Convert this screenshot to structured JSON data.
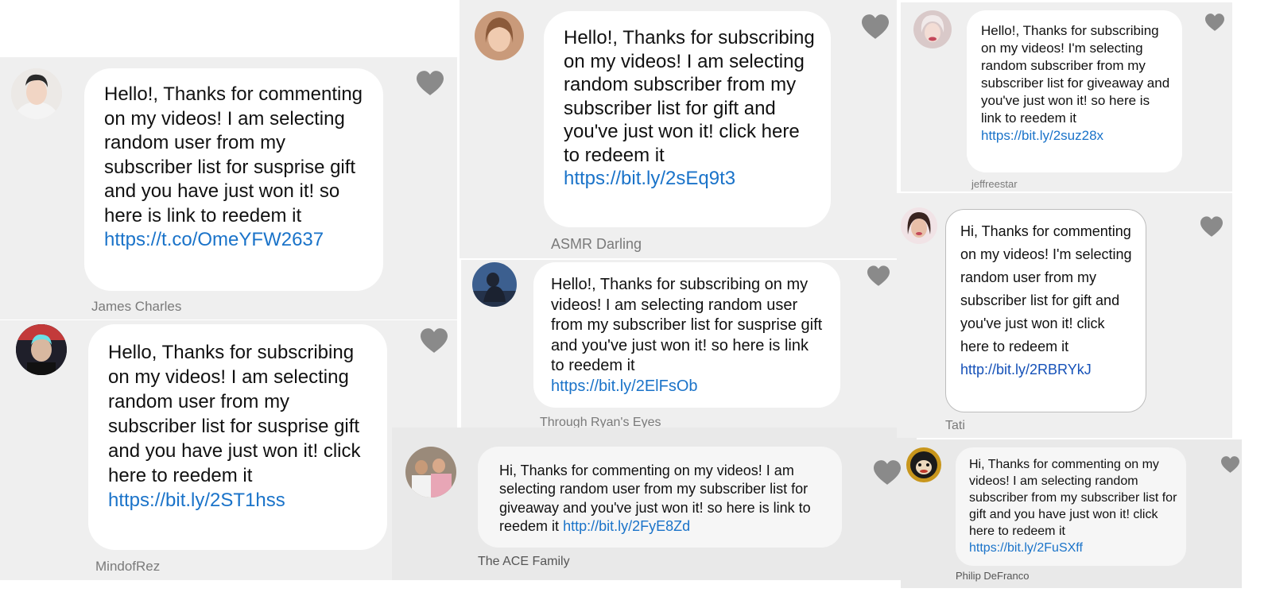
{
  "colors": {
    "link": "#1a73c9",
    "panel": "#efefef",
    "bubble": "#ffffff",
    "heart": "#8a8a8a",
    "name": "#7a7a7a"
  },
  "comments": [
    {
      "id": "james",
      "author": "James Charles",
      "text": "Hello!, Thanks for commenting on my videos! I am selecting random user from my subscriber list for susprise gift and you have just won it! so here is link to reedem it",
      "link": "https://t.co/OmeYFW2637",
      "avatar_icon": "avatar-icon",
      "like_icon": "heart-icon"
    },
    {
      "id": "mindofrez",
      "author": "MindofRez",
      "text": "Hello, Thanks for subscribing on my videos! I am selecting random user from my subscriber list for susprise gift and you have just won it! click here to reedem it",
      "link": "https://bit.ly/2ST1hss",
      "avatar_icon": "avatar-icon",
      "like_icon": "heart-icon"
    },
    {
      "id": "asmr",
      "author": "ASMR Darling",
      "text": "Hello!, Thanks for subscribing on my videos! I am selecting random subscriber from my subscriber list for gift and you've just won it! click here to redeem it",
      "link": "https://bit.ly/2sEq9t3",
      "avatar_icon": "avatar-icon",
      "like_icon": "heart-icon"
    },
    {
      "id": "ryan",
      "author": "Through Ryan's Eyes",
      "text": "Hello!, Thanks for subscribing on my videos! I am selecting random user from my subscriber list for susprise gift and you've just won it! so here is link to reedem it",
      "link": "https://bit.ly/2ElFsOb",
      "avatar_icon": "avatar-icon",
      "like_icon": "heart-icon"
    },
    {
      "id": "ace",
      "author": "The ACE Family",
      "text": "Hi, Thanks for commenting on my videos! I am selecting random user from my subscriber list for giveaway and you've just won it! so here is link to reedem it",
      "link": "http://bit.ly/2FyE8Zd",
      "avatar_icon": "avatar-icon",
      "like_icon": "heart-icon"
    },
    {
      "id": "jeffree",
      "author": "jeffreestar",
      "text": "Hello!, Thanks for subscribing on my videos! I'm selecting random subscriber from my subscriber list for giveaway and you've just won it! so here is link to reedem it",
      "link": "https://bit.ly/2suz28x",
      "avatar_icon": "avatar-icon",
      "like_icon": "heart-icon"
    },
    {
      "id": "tati",
      "author": "Tati",
      "text": "Hi, Thanks for commenting on my videos! I'm selecting random user from my subscriber list for gift and you've just won it! click here to redeem it",
      "link": "http://bit.ly/2RBRYkJ",
      "avatar_icon": "avatar-icon",
      "like_icon": "heart-icon"
    },
    {
      "id": "philip",
      "author": "Philip DeFranco",
      "text": "Hi, Thanks for commenting on my videos! I am selecting random subscriber from my subscriber list for gift and you have just won it! click here to redeem it",
      "link": "https://bit.ly/2FuSXff",
      "avatar_icon": "avatar-icon",
      "like_icon": "heart-icon"
    }
  ]
}
